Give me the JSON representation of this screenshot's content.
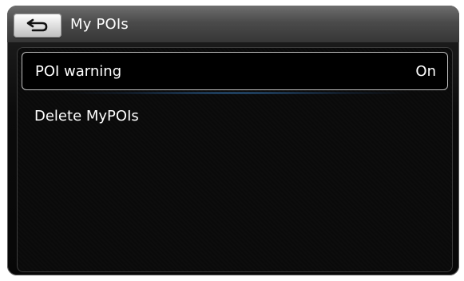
{
  "header": {
    "title": "My POIs",
    "back_icon": "back-arrow-icon"
  },
  "menu": {
    "items": [
      {
        "label": "POI warning",
        "value": "On",
        "selected": true
      },
      {
        "label": "Delete MyPOIs"
      }
    ]
  },
  "colors": {
    "text": "#ffffff",
    "selection_border": "#bfbfbf",
    "glow": "#3c8cd2"
  }
}
